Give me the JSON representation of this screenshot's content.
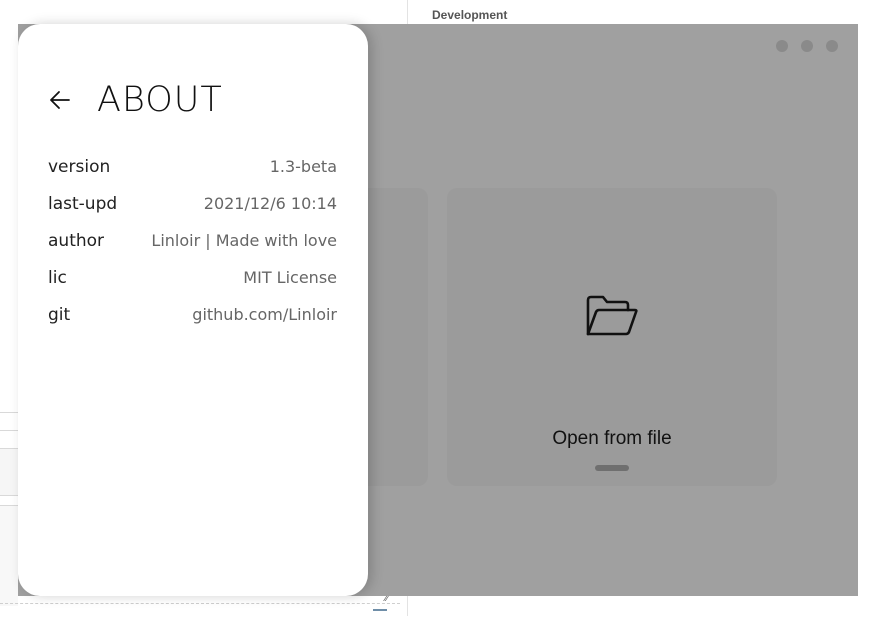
{
  "background": {
    "tab_label": "Development"
  },
  "about": {
    "title": "ABOUT",
    "back_icon": "arrow-left-icon",
    "rows": [
      {
        "key": "version",
        "value": "1.3-beta"
      },
      {
        "key": "last-upd",
        "value": "2021/12/6 10:14"
      },
      {
        "key": "author",
        "value": "Linloir | Made with love"
      },
      {
        "key": "lic",
        "value": "MIT License"
      },
      {
        "key": "git",
        "value": "github.com/Linloir"
      }
    ]
  },
  "app": {
    "open_card": {
      "icon": "folder-open-icon",
      "label": "Open from file"
    },
    "window_controls": [
      "dot-icon",
      "dot-icon",
      "dot-icon"
    ]
  },
  "colors": {
    "overlay": "#a0a0a0",
    "card": "#9b9b9b",
    "panel": "#ffffff"
  }
}
